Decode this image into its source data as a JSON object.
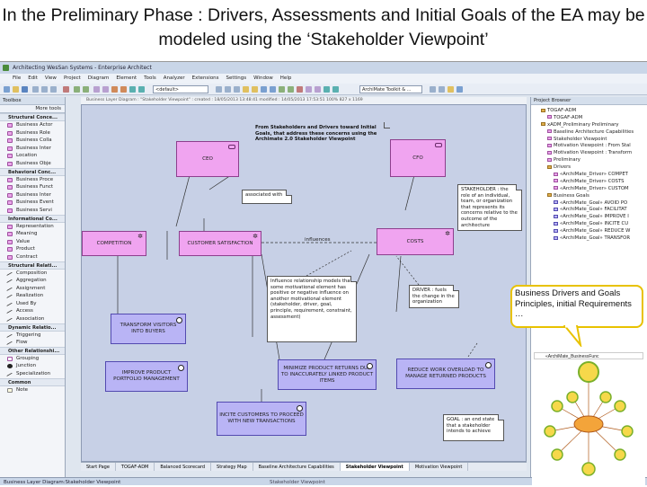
{
  "slide": {
    "title": "In the Preliminary Phase : Drivers, Assessments and Initial Goals of the EA may be modeled using the ‘Stakeholder Viewpoint’"
  },
  "window": {
    "title": "Architecting WesSan Systems - Enterprise Architect"
  },
  "menu": [
    "File",
    "Edit",
    "View",
    "Project",
    "Diagram",
    "Element",
    "Tools",
    "Analyzer",
    "Extensions",
    "Settings",
    "Window",
    "Help"
  ],
  "toolbar": {
    "default_select": "<default>",
    "archimate_select": "ArchiMate Toolkit & ..."
  },
  "toolbox": {
    "title": "Toolbox",
    "subtitle": "More tools",
    "sections": [
      {
        "name": "Structural Conce...",
        "items": [
          "Business Actor",
          "Business Role",
          "Business Colla",
          "Business Inter",
          "Location",
          "Business Obje"
        ]
      },
      {
        "name": "Behavioral Conc...",
        "items": [
          "Business Proce",
          "Business Funct",
          "Business Inter",
          "Business Event",
          "Business Servi"
        ]
      },
      {
        "name": "Informational Co...",
        "items": [
          "Representation",
          "Meaning",
          "Value",
          "Product",
          "Contract"
        ]
      },
      {
        "name": "Structural Relati...",
        "items": [
          "Composition",
          "Aggregation",
          "Assignment",
          "Realization",
          "Used By",
          "Access",
          "Association"
        ]
      },
      {
        "name": "Dynamic Relatio...",
        "items": [
          "Triggering",
          "Flow"
        ]
      },
      {
        "name": "Other Relationshi...",
        "items": [
          "Grouping",
          "Junction",
          "Specialization"
        ]
      },
      {
        "name": "Common",
        "items": [
          "Note"
        ]
      }
    ]
  },
  "diagram": {
    "header": "Business Layer Diagram : \"Stakeholder Viewpoint\" : created : 18/05/2013 13:48:41 modified : 14/05/2013 17:53:51   100%   827 x 1169",
    "elements": {
      "ceo": "CEO",
      "cfo": "CFO",
      "competition": "COMPETITION",
      "customer_satisfaction": "CUSTOMER SATISFACTION",
      "costs": "COSTS",
      "transform_visitors": "TRANSFORM VISITORS INTO BUYERS",
      "improve_portfolio": "IMPROVE PRODUCT PORTFOLIO MANAGEMENT",
      "minimize_returns": "MINIMIZE PRODUCT RETURNS DUE TO INACCURATELY LINKED PRODUCT ITEMS",
      "reduce_workload": "REDUCE WORK OVERLOAD TO MANAGE RETURNED PRODUCTS",
      "incite_customers": "INCITE CUSTOMERS TO PROCEED WITH NEW TRANSACTIONS"
    },
    "notes": {
      "intro": "From Stakeholders and Drivers toward Initial Goals, that address these concerns using the Archimate 2.0 Stakeholder Viewpoint",
      "associated": "associated with",
      "stakeholder": "STAKEHOLDER : the role of an individual, team, or organization that represents its concerns relative to the outcome of the architecture",
      "influence": "Influence relationship models that some motivational element has positive or negative influence on another motivational element (stakeholder, driver, goal, principle, requirement, constraint, assessment)",
      "driver": "DRIVER : fuels the change in the organization",
      "goal": "GOAL : an end state that a stakeholder intends to achieve"
    },
    "labels": {
      "influences": "influences"
    }
  },
  "tabs": [
    "Start Page",
    "TOGAF-ADM",
    "Balanced Scorecard",
    "Strategy Map",
    "Baseline Architecture Capabilities",
    "Stakeholder Viewpoint",
    "Motivation Viewpoint"
  ],
  "active_tab": "Stakeholder Viewpoint",
  "browser": {
    "title": "Project Browser",
    "tree": [
      {
        "label": "TOGAF-ADM",
        "depth": 1,
        "kind": "folder"
      },
      {
        "label": "TOGAF-ADM",
        "depth": 2,
        "kind": "el"
      },
      {
        "label": "xADM_Preliminary Preliminary",
        "depth": 1,
        "kind": "folder"
      },
      {
        "label": "Baseline Architecture Capabilities",
        "depth": 2,
        "kind": "el"
      },
      {
        "label": "Stakeholder Viewpoint",
        "depth": 2,
        "kind": "el"
      },
      {
        "label": "Motivation Viewpoint : From Stal",
        "depth": 2,
        "kind": "el"
      },
      {
        "label": "Motivation Viewpoint : Transform",
        "depth": 2,
        "kind": "el"
      },
      {
        "label": "Preliminary",
        "depth": 2,
        "kind": "el"
      },
      {
        "label": "Drivers",
        "depth": 2,
        "kind": "folder"
      },
      {
        "label": "«ArchiMate_Driver» COMPET",
        "depth": 3,
        "kind": "el"
      },
      {
        "label": "«ArchiMate_Driver» COSTS",
        "depth": 3,
        "kind": "el"
      },
      {
        "label": "«ArchiMate_Driver» CUSTOM",
        "depth": 3,
        "kind": "el"
      },
      {
        "label": "Business Goals",
        "depth": 2,
        "kind": "folder"
      },
      {
        "label": "«ArchiMate_Goal» AVOID PO",
        "depth": 3,
        "kind": "gl"
      },
      {
        "label": "«ArchiMate_Goal» FACILITAT",
        "depth": 3,
        "kind": "gl"
      },
      {
        "label": "«ArchiMate_Goal» IMPROVE I",
        "depth": 3,
        "kind": "gl"
      },
      {
        "label": "«ArchiMate_Goal» INCITE CU",
        "depth": 3,
        "kind": "gl"
      },
      {
        "label": "«ArchiMate_Goal» REDUCE W",
        "depth": 3,
        "kind": "gl"
      },
      {
        "label": "«ArchiMate_Goal» TRANSFOR",
        "depth": 3,
        "kind": "gl"
      }
    ],
    "bottom_item": "«ArchiMate_BusinessFunc"
  },
  "callout": {
    "line1": "Business Drivers and Goals",
    "line2": "Principles, initial Requirements",
    "line3": "…"
  },
  "status": {
    "left": "Business Layer Diagram:Stakeholder Viewpoint",
    "middle": "Stakeholder Viewpoint"
  },
  "colors": {
    "driver": "#f0a4f0",
    "goal": "#b9b4f5",
    "canvas": "#c7d0e6",
    "callout_border": "#e8c200"
  }
}
